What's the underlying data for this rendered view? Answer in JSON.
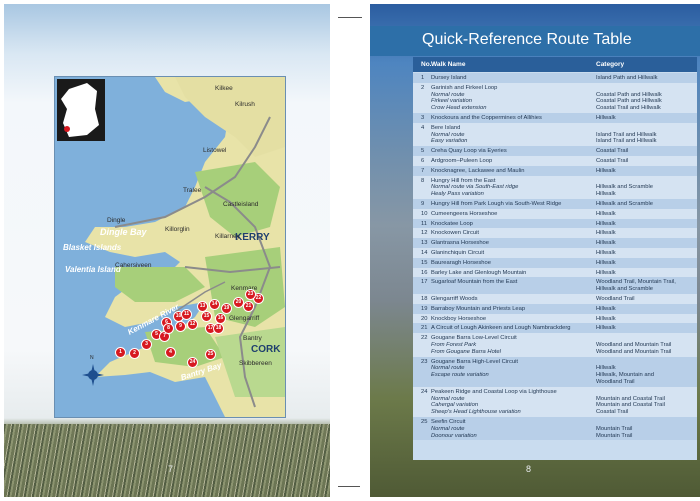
{
  "left_page": {
    "page_number": "7",
    "map": {
      "sea_labels": [
        "Blasket Islands",
        "Dingle Bay",
        "Valentia Island",
        "Kenmare River",
        "Bantry Bay"
      ],
      "county_labels": [
        "KERRY",
        "CORK"
      ],
      "towns": [
        "Kilkee",
        "Kilrush",
        "Listowel",
        "Tralee",
        "Dingle",
        "Castleisland",
        "Killorglin",
        "Killarney",
        "Cahersiveen",
        "Kenmare",
        "Glengarriff",
        "Bantry",
        "Skibbereen"
      ],
      "roads": [
        "N68",
        "N69",
        "N21",
        "N86",
        "N70",
        "N72",
        "N22",
        "N71"
      ],
      "markers": [
        "1",
        "2",
        "3",
        "4",
        "5",
        "6",
        "7",
        "8",
        "9",
        "10",
        "11",
        "12",
        "13",
        "14",
        "15",
        "16",
        "17",
        "18",
        "19",
        "20",
        "21",
        "22",
        "23",
        "24",
        "25"
      ],
      "compass_label": "N"
    }
  },
  "right_page": {
    "title": "Quick-Reference Route Table",
    "page_number": "8",
    "columns": [
      "No.",
      "Walk Name",
      "Category"
    ],
    "rows": [
      {
        "no": "1",
        "name": "Dursey Island",
        "subs": [],
        "category": [
          "Island Path and Hillwalk"
        ]
      },
      {
        "no": "2",
        "name": "Garinish and Firkeel Loop",
        "subs": [
          "Normal route",
          "Firkeel variation",
          "Crow Head extension"
        ],
        "category": [
          "",
          "Coastal Path and Hillwalk",
          "Coastal Path and Hillwalk",
          "Coastal Trail and Hillwalk"
        ]
      },
      {
        "no": "3",
        "name": "Knockoura and the Coppermines of Allihies",
        "subs": [],
        "category": [
          "Hillwalk"
        ]
      },
      {
        "no": "4",
        "name": "Bere Island",
        "subs": [
          "Normal route",
          "Easy variation"
        ],
        "category": [
          "",
          "Island Trail and Hillwalk",
          "Island Trail and Hillwalk"
        ]
      },
      {
        "no": "5",
        "name": "Creha Quay Loop via Eyeries",
        "subs": [],
        "category": [
          "Coastal Trail"
        ]
      },
      {
        "no": "6",
        "name": "Ardgroom–Puleen Loop",
        "subs": [],
        "category": [
          "Coastal Trail"
        ]
      },
      {
        "no": "7",
        "name": "Knocknagree, Lackawee and Maulin",
        "subs": [],
        "category": [
          "Hillwalk"
        ]
      },
      {
        "no": "8",
        "name": "Hungry Hill from the East",
        "subs": [
          "Normal route via South-East ridge",
          "Healy Pass variation"
        ],
        "category": [
          "",
          "Hillwalk and Scramble",
          "Hillwalk"
        ]
      },
      {
        "no": "9",
        "name": "Hungry Hill from Park Lough via South-West Ridge",
        "subs": [],
        "category": [
          "Hillwalk and Scramble"
        ]
      },
      {
        "no": "10",
        "name": "Cumeengeera Horseshoe",
        "subs": [],
        "category": [
          "Hillwalk"
        ]
      },
      {
        "no": "11",
        "name": "Knockatee Loop",
        "subs": [],
        "category": [
          "Hillwalk"
        ]
      },
      {
        "no": "12",
        "name": "Knockowen Circuit",
        "subs": [],
        "category": [
          "Hillwalk"
        ]
      },
      {
        "no": "13",
        "name": "Glantrasna Horseshoe",
        "subs": [],
        "category": [
          "Hillwalk"
        ]
      },
      {
        "no": "14",
        "name": "Glaninchiquin Circuit",
        "subs": [],
        "category": [
          "Hillwalk"
        ]
      },
      {
        "no": "15",
        "name": "Baurearagh Horseshoe",
        "subs": [],
        "category": [
          "Hillwalk"
        ]
      },
      {
        "no": "16",
        "name": "Barley Lake and Glenlough Mountain",
        "subs": [],
        "category": [
          "Hillwalk"
        ]
      },
      {
        "no": "17",
        "name": "Sugarloaf Mountain from the East",
        "subs": [],
        "category": [
          "Woodland Trail, Mountain Trail,",
          "Hillwalk and Scramble"
        ]
      },
      {
        "no": "18",
        "name": "Glengarriff Woods",
        "subs": [],
        "category": [
          "Woodland Trail"
        ]
      },
      {
        "no": "19",
        "name": "Barraboy Mountain and Priests Leap",
        "subs": [],
        "category": [
          "Hillwalk"
        ]
      },
      {
        "no": "20",
        "name": "Knockboy Horseshoe",
        "subs": [],
        "category": [
          "Hillwalk"
        ]
      },
      {
        "no": "21",
        "name": "A Circuit of Lough Akinkeen and Lough Nambrackderg",
        "subs": [],
        "category": [
          "Hillwalk"
        ]
      },
      {
        "no": "22",
        "name": "Gougane Barra Low-Level Circuit",
        "subs": [
          "From Forest Park",
          "From Gougane Barra Hotel"
        ],
        "category": [
          "",
          "Woodland and Mountain Trail",
          "Woodland and Mountain Trail"
        ]
      },
      {
        "no": "23",
        "name": "Gougane Barra High-Level Circuit",
        "subs": [
          "Normal route",
          "Escape route variation"
        ],
        "category": [
          "",
          "Hillwalk",
          "Hillwalk, Mountain and",
          "Woodland Trail"
        ]
      },
      {
        "no": "24",
        "name": "Peakeen Ridge and Coastal Loop via Lighthouse",
        "subs": [
          "Normal route",
          "Cahergal variation",
          "Sheep's Head Lighthouse variation"
        ],
        "category": [
          "",
          "Mountain and Coastal Trail",
          "Mountain and Coastal Trail",
          "Coastal Trail"
        ]
      },
      {
        "no": "25",
        "name": "Seefin Circuit",
        "subs": [
          "Normal route",
          "Doonour variation"
        ],
        "category": [
          "",
          "Mountain Trail",
          "Mountain Trail"
        ]
      }
    ]
  }
}
